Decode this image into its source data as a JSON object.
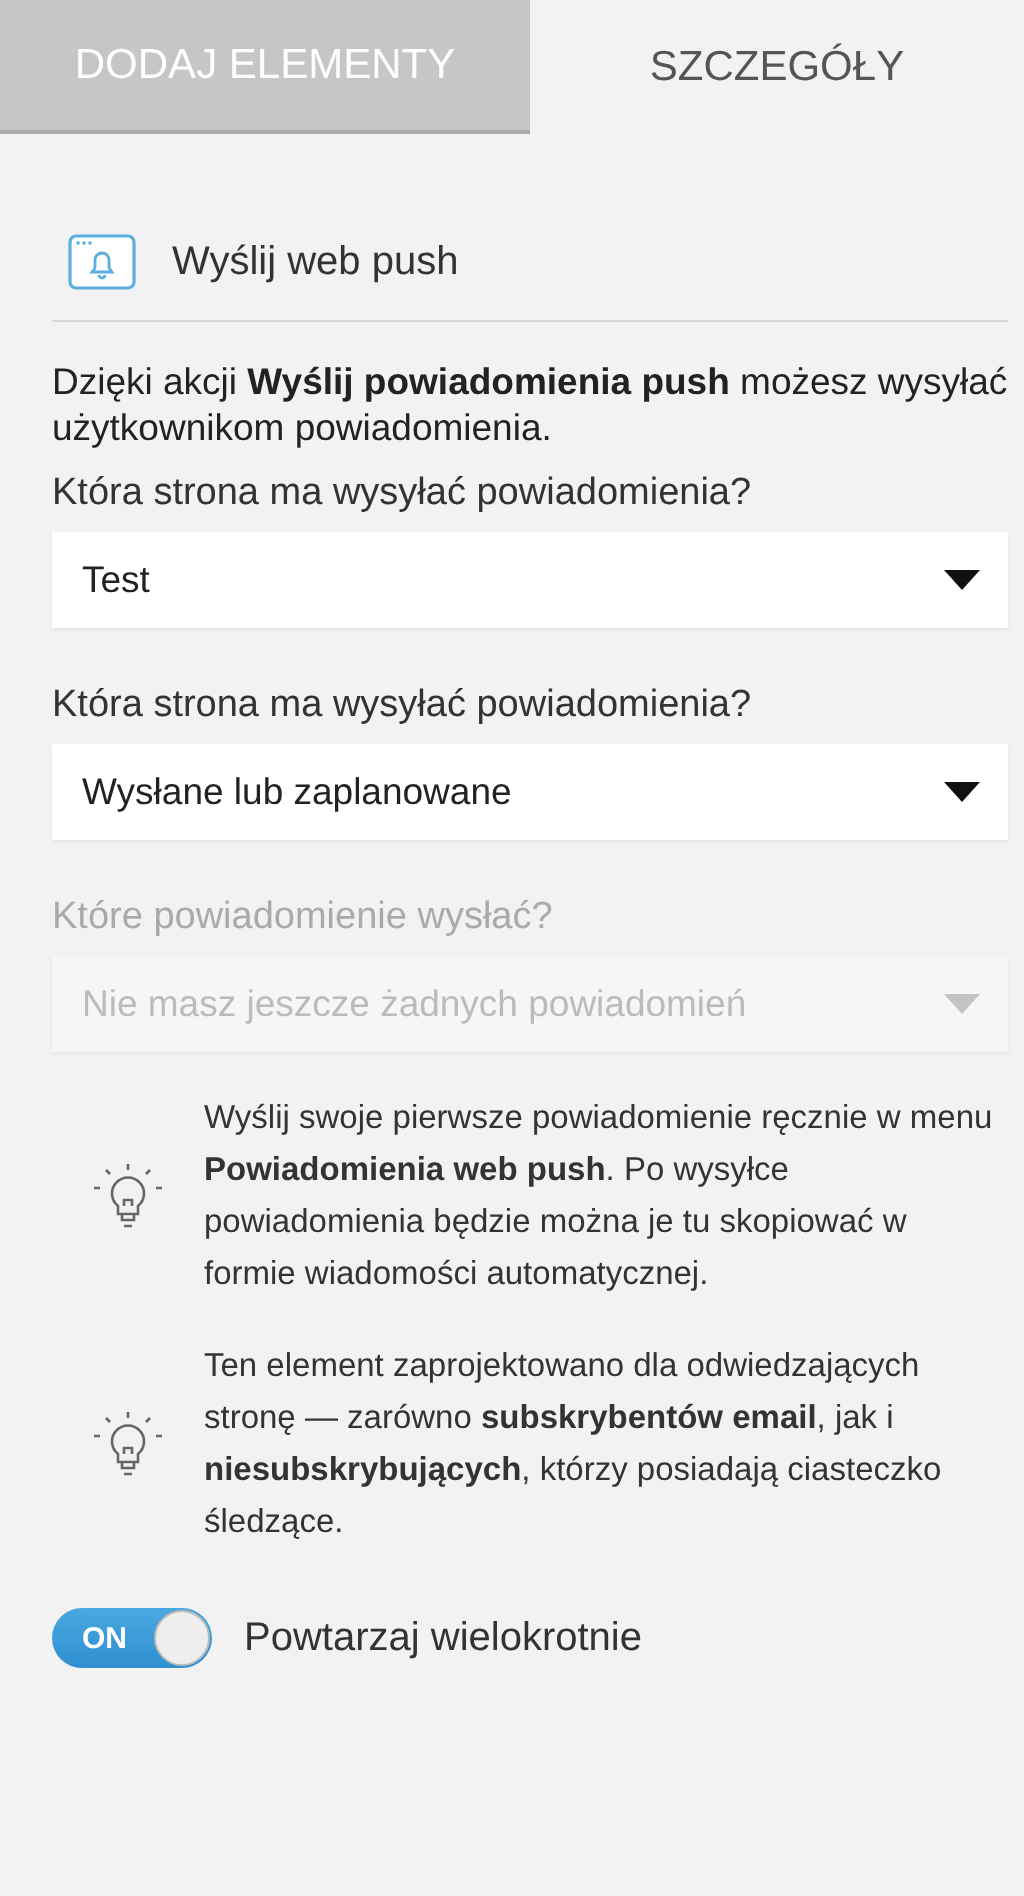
{
  "tabs": [
    {
      "label": "DODAJ ELEMENTY",
      "selected": false
    },
    {
      "label": "SZCZEGÓŁY",
      "selected": true
    }
  ],
  "header": {
    "title": "Wyślij web push"
  },
  "intro": "Dzięki akcji **Wyślij powiadomienia push** możesz wysyłać użytkownikom powiadomienia.",
  "fields": [
    {
      "label": "Która strona ma wysyłać powiadomienia?",
      "value": "Test",
      "disabled": false
    },
    {
      "label": "Która strona ma wysyłać powiadomienia?",
      "value": "Wysłane lub zaplanowane",
      "disabled": false
    },
    {
      "label": "Które powiadomienie wysłać?",
      "value": "Nie masz jeszcze żadnych powiadomień",
      "disabled": true
    }
  ],
  "tips": [
    "Wyślij swoje pierwsze powiadomienie ręcznie w menu **Powiadomienia web push**. Po wysyłce powiadomienia będzie można je tu skopiować w formie wiadomości automatycznej.",
    "Ten element zaprojektowano dla odwiedzających stronę — zarówno **subskrybentów email**, jak i **niesubskrybujących**, którzy posiadają ciasteczko śledzące."
  ],
  "toggle": {
    "label": "Powtarzaj wielokrotnie",
    "on": true,
    "text": "ON"
  }
}
